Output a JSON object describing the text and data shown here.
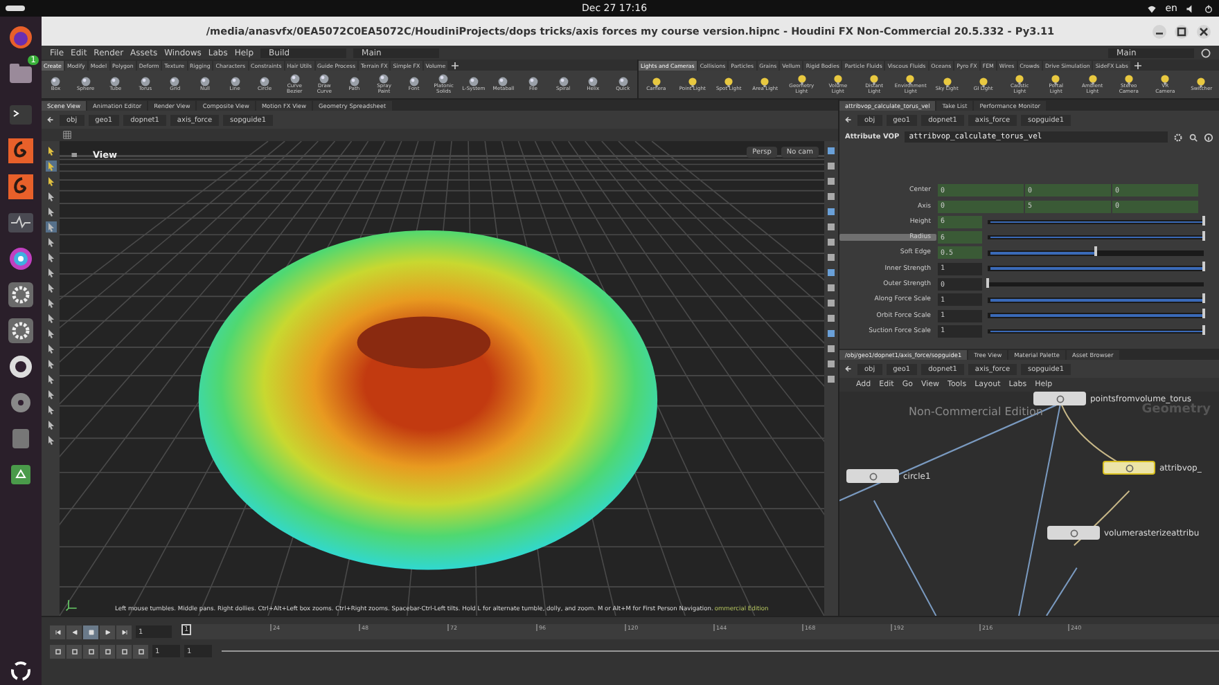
{
  "top_bar": {
    "date_time": "Dec 27  17:16",
    "language": "en"
  },
  "dock": {
    "badge": "1"
  },
  "window": {
    "title": "/media/anasvfx/0EA5072C0EA5072C/HoudiniProjects/dops tricks/axis forces my course version.hipnc - Houdini FX Non-Commercial 20.5.332 - Py3.11"
  },
  "menu_bar": {
    "items": [
      "File",
      "Edit",
      "Render",
      "Assets",
      "Windows",
      "Labs",
      "Help"
    ],
    "desktop": "Build",
    "workspace": "Main",
    "right_workspace": "Main"
  },
  "shelf_left": {
    "tabs": [
      {
        "label": "Create",
        "selected": true
      },
      {
        "label": "Modify",
        "selected": false
      },
      {
        "label": "Model",
        "selected": false
      },
      {
        "label": "Polygon",
        "selected": false
      },
      {
        "label": "Deform",
        "selected": false
      },
      {
        "label": "Texture",
        "selected": false
      },
      {
        "label": "Rigging",
        "selected": false
      },
      {
        "label": "Characters",
        "selected": false
      },
      {
        "label": "Constraints",
        "selected": false
      },
      {
        "label": "Hair Utils",
        "selected": false
      },
      {
        "label": "Guide Process",
        "selected": false
      },
      {
        "label": "Terrain FX",
        "selected": false
      },
      {
        "label": "Simple FX",
        "selected": false
      },
      {
        "label": "Volume",
        "selected": false
      }
    ],
    "tools": [
      "Box",
      "Sphere",
      "Tube",
      "Torus",
      "Grid",
      "Null",
      "Line",
      "Circle",
      "Curve Bezier",
      "Draw Curve",
      "Path",
      "Spray Paint",
      "Font",
      "Platonic Solids",
      "L-System",
      "Metaball",
      "File",
      "Spiral",
      "Helix",
      "Quick"
    ]
  },
  "shelf_right": {
    "tabs": [
      {
        "label": "Lights and Cameras",
        "selected": true
      },
      {
        "label": "Collisions",
        "selected": false
      },
      {
        "label": "Particles",
        "selected": false
      },
      {
        "label": "Grains",
        "selected": false
      },
      {
        "label": "Vellum",
        "selected": false
      },
      {
        "label": "Rigid Bodies",
        "selected": false
      },
      {
        "label": "Particle Fluids",
        "selected": false
      },
      {
        "label": "Viscous Fluids",
        "selected": false
      },
      {
        "label": "Oceans",
        "selected": false
      },
      {
        "label": "Pyro FX",
        "selected": false
      },
      {
        "label": "FEM",
        "selected": false
      },
      {
        "label": "Wires",
        "selected": false
      },
      {
        "label": "Crowds",
        "selected": false
      },
      {
        "label": "Drive Simulation",
        "selected": false
      },
      {
        "label": "SideFX Labs",
        "selected": false
      }
    ],
    "tools": [
      "Camera",
      "Point Light",
      "Spot Light",
      "Area Light",
      "Geometry Light",
      "Volume Light",
      "Distant Light",
      "Environment Light",
      "Sky Light",
      "GI Light",
      "Caustic Light",
      "Portal Light",
      "Ambient Light",
      "Stereo Camera",
      "VR Camera",
      "Switcher"
    ]
  },
  "viewer_tabs": [
    {
      "label": "Scene View",
      "selected": true
    },
    {
      "label": "Animation Editor",
      "selected": false
    },
    {
      "label": "Render View",
      "selected": false
    },
    {
      "label": "Composite View",
      "selected": false
    },
    {
      "label": "Motion FX View",
      "selected": false
    },
    {
      "label": "Geometry Spreadsheet",
      "selected": false
    }
  ],
  "viewer_path": [
    "obj",
    "geo1",
    "dopnet1",
    "axis_force",
    "sopguide1"
  ],
  "viewport": {
    "title": "View",
    "camera_view": "Persp",
    "camera": "No cam",
    "hint": "Left mouse tumbles. Middle pans. Right dollies. Ctrl+Alt+Left box zooms. Ctrl+Right zooms. Spacebar-Ctrl-Left tilts. Hold L for alternate tumble, dolly, and zoom. M or Alt+M for First Person Navigation.",
    "watermark": "ommercial Edition"
  },
  "param_tabs": [
    {
      "label": "attribvop_calculate_torus_vel",
      "selected": true
    },
    {
      "label": "Take List",
      "selected": false
    },
    {
      "label": "Performance Monitor",
      "selected": false
    }
  ],
  "param_path": [
    "obj",
    "geo1",
    "dopnet1",
    "axis_force",
    "sopguide1"
  ],
  "parameters": {
    "node_type": "Attribute VOP",
    "node_name": "attribvop_calculate_torus_vel",
    "rows": [
      {
        "kind": "vector",
        "label": "Center",
        "hovered": false,
        "changed": true,
        "values": [
          "0",
          "0",
          "0"
        ]
      },
      {
        "kind": "vector",
        "label": "Axis",
        "hovered": false,
        "changed": true,
        "values": [
          "0",
          "5",
          "0"
        ]
      },
      {
        "kind": "slider",
        "label": "Height",
        "hovered": false,
        "changed": true,
        "values": [
          "6"
        ],
        "level": 1
      },
      {
        "kind": "slider",
        "label": "Radius",
        "hovered": true,
        "changed": true,
        "values": [
          "6"
        ],
        "level": 1
      },
      {
        "kind": "slider",
        "label": "Soft Edge",
        "hovered": false,
        "changed": true,
        "values": [
          "0.5"
        ],
        "level": 0.5
      },
      {
        "kind": "slider",
        "label": "Inner Strength",
        "hovered": false,
        "changed": false,
        "values": [
          "1"
        ],
        "level": 1
      },
      {
        "kind": "slider",
        "label": "Outer Strength",
        "hovered": false,
        "changed": false,
        "values": [
          "0"
        ],
        "level": 0
      },
      {
        "kind": "slider",
        "label": "Along Force Scale",
        "hovered": false,
        "changed": false,
        "values": [
          "1"
        ],
        "level": 1
      },
      {
        "kind": "slider",
        "label": "Orbit Force Scale",
        "hovered": false,
        "changed": false,
        "values": [
          "1"
        ],
        "level": 1
      },
      {
        "kind": "slider",
        "label": "Suction Force Scale",
        "hovered": false,
        "changed": false,
        "values": [
          "1"
        ],
        "level": 1
      }
    ]
  },
  "network_tabs": [
    {
      "label": "/obj/geo1/dopnet1/axis_force/sopguide1",
      "selected": true
    },
    {
      "label": "Tree View",
      "selected": false
    },
    {
      "label": "Material Palette",
      "selected": false
    },
    {
      "label": "Asset Browser",
      "selected": false
    }
  ],
  "network_path": [
    "obj",
    "geo1",
    "dopnet1",
    "axis_force",
    "sopguide1"
  ],
  "network_menu": [
    "Add",
    "Edit",
    "Go",
    "View",
    "Tools",
    "Layout",
    "Labs",
    "Help"
  ],
  "network": {
    "watermark": "Non-Commercial Edition",
    "context": "Geometry",
    "nodes": [
      {
        "name": "pointsfromvolume_torus",
        "selected": false
      },
      {
        "name": "circle1",
        "selected": false
      },
      {
        "name": "attribvop_",
        "selected": true
      },
      {
        "name": "volumerasterizeattribu",
        "selected": false
      }
    ]
  },
  "timeline": {
    "frame": "1",
    "marker": "1",
    "ticks": [
      "24",
      "48",
      "72",
      "96",
      "120",
      "144",
      "168",
      "192",
      "216",
      "240"
    ],
    "start": "1",
    "end": "1"
  }
}
